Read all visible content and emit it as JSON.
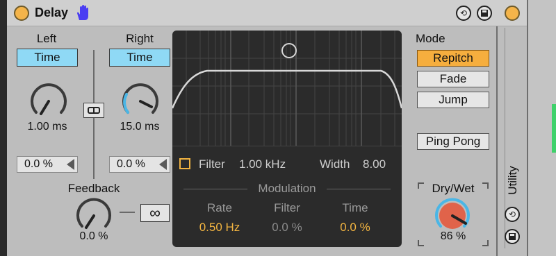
{
  "delay": {
    "title": "Delay",
    "left": {
      "label": "Left",
      "mode": "Time",
      "time": "1.00 ms",
      "offset": "0.0 %"
    },
    "right": {
      "label": "Right",
      "mode": "Time",
      "time": "15.0 ms",
      "offset": "0.0 %"
    },
    "feedback": {
      "label": "Feedback",
      "value": "0.0 %",
      "freeze_symbol": "∞"
    },
    "filter": {
      "label": "Filter",
      "freq": "1.00 kHz",
      "width_label": "Width",
      "width": "8.00"
    },
    "modulation": {
      "label": "Modulation",
      "rate_label": "Rate",
      "rate": "0.50 Hz",
      "filter_label": "Filter",
      "filter": "0.0 %",
      "time_label": "Time",
      "time": "0.0 %"
    },
    "mode": {
      "label": "Mode",
      "options": [
        "Repitch",
        "Fade",
        "Jump"
      ],
      "selected": "Repitch"
    },
    "ping_pong": "Ping Pong",
    "dry_wet": {
      "label": "Dry/Wet",
      "value": "86 %",
      "level": 0.86
    }
  },
  "utility": {
    "title": "Utility"
  },
  "colors": {
    "accent": "#f6ae3e",
    "time_button": "#8fd9f5",
    "panel": "#2b2b2b",
    "knob_active": "#e0634a"
  }
}
